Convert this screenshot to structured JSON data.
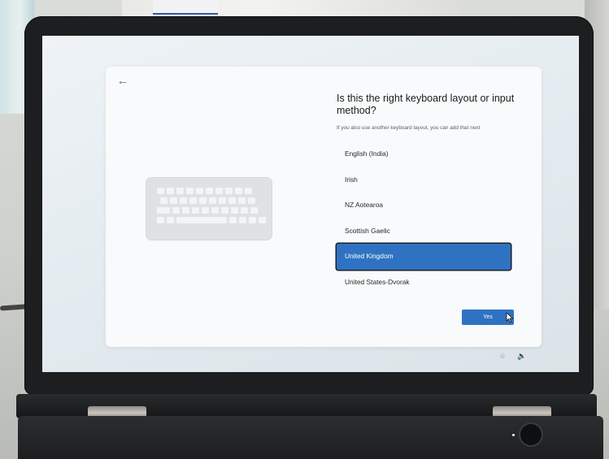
{
  "oobe": {
    "back_glyph": "←",
    "title": "Is this the right keyboard layout or input method?",
    "subtitle": "If you also use another keyboard layout, you can add that next",
    "layouts": [
      {
        "label": "English (India)",
        "selected": false
      },
      {
        "label": "Irish",
        "selected": false
      },
      {
        "label": "NZ Aotearoa",
        "selected": false
      },
      {
        "label": "Scottish Gaelic",
        "selected": false
      },
      {
        "label": "United Kingdom",
        "selected": true
      },
      {
        "label": "United States-Dvorak",
        "selected": false
      }
    ],
    "yes_label": "Yes",
    "accent_color": "#2f72c2"
  },
  "taskbar": {
    "accessibility_icon": "accessibility-icon",
    "accessibility_glyph": "☆",
    "volume_icon": "volume-icon",
    "volume_glyph": "🔈"
  }
}
